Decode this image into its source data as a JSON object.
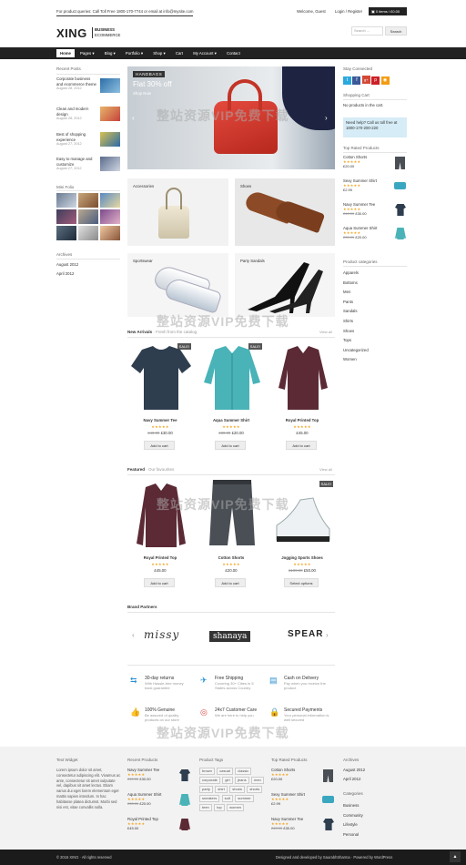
{
  "topbar": {
    "contact": "For product queries: Call Toll Free 1800-170-7744 or email at info@mysite.com",
    "welcome": "Welcome, Guest",
    "login": "Login / Register",
    "cart": "0 items / £0.00"
  },
  "logo": {
    "name": "XING",
    "line1": "BUSINESS",
    "line2": "ECOMMERCE"
  },
  "search": {
    "placeholder": "Search ...",
    "button": "Search"
  },
  "nav": [
    "Home",
    "Pages",
    "Blog",
    "Portfolio",
    "Shop",
    "Cart",
    "My Account",
    "Contact"
  ],
  "recent_posts": {
    "title": "Recent Posts",
    "items": [
      {
        "title": "Corporate business and ecommerce theme",
        "date": "August 28, 2012"
      },
      {
        "title": "Clean and modern design",
        "date": "August 28, 2012"
      },
      {
        "title": "Best of shopping experience",
        "date": "August 27, 2012"
      },
      {
        "title": "Easy to manage and customize",
        "date": "August 27, 2012"
      }
    ]
  },
  "mini_folio": {
    "title": "Mini Folio"
  },
  "archives": {
    "title": "Archives",
    "items": [
      "August 2012",
      "April 2012"
    ]
  },
  "slider": {
    "label": "HANDBAGS",
    "headline": "Flat 30% off",
    "cta": "Shop Now"
  },
  "categories_tiles": [
    "Accessories",
    "Shoes",
    "Sportswear",
    "Party Sandals"
  ],
  "new_arrivals": {
    "title": "New Arrivals",
    "sub": "Fresh from the catalog",
    "view_all": "View all",
    "products": [
      {
        "name": "Navy Summer Tee",
        "old": "£40.00",
        "price": "£30.00",
        "button": "Add to cart",
        "sale": "SALE!"
      },
      {
        "name": "Aqua Summer Shirt",
        "old": "£30.00",
        "price": "£20.00",
        "button": "Add to cart",
        "sale": "SALE!"
      },
      {
        "name": "Royal Printed Top",
        "old": "",
        "price": "£45.00",
        "button": "Add to cart",
        "sale": ""
      }
    ]
  },
  "featured": {
    "title": "Featured",
    "sub": "Our favourites",
    "view_all": "View all",
    "products": [
      {
        "name": "Royal Printed Top",
        "price": "£45.00",
        "button": "Add to cart",
        "sale": ""
      },
      {
        "name": "Cotton Shorts",
        "price": "£20.00",
        "button": "Add to cart",
        "sale": ""
      },
      {
        "name": "Jogging Sports Shoes",
        "old": "£100.00",
        "price": "£50.00",
        "button": "Select options",
        "sale": "SALE!"
      }
    ]
  },
  "brands": {
    "title": "Brand Partners",
    "items": [
      "missy",
      "shanaya",
      "SPEAR"
    ]
  },
  "features": [
    {
      "title": "30-day returns",
      "text": "With Hassle-free money back guarantee"
    },
    {
      "title": "Free Shipping",
      "text": "Covering 30+ Cities in 5 States across Country"
    },
    {
      "title": "Cash on Delivery",
      "text": "Pay when you receive the product"
    },
    {
      "title": "100% Genuine",
      "text": "Be assured of quality products on our store"
    },
    {
      "title": "24x7 Customer Care",
      "text": "We are here to help you"
    },
    {
      "title": "Secured Payments",
      "text": "Your personal information is well secured"
    }
  ],
  "right": {
    "stay_connected": "Stay Connected",
    "shopping_cart": "Shopping Cart",
    "cart_empty": "No products in the cart.",
    "help": "Need help? Call us toll free at 1800-170-200-220",
    "top_rated": "Top Rated Products",
    "top_items": [
      {
        "name": "Cotton Shorts",
        "price": "£20.00"
      },
      {
        "name": "Sexy Summer Shirt",
        "price": "£2.99"
      },
      {
        "name": "Navy Summer Tee",
        "old": "£40.00",
        "price": "£30.00"
      },
      {
        "name": "Aqua Summer Shirt",
        "old": "£30.00",
        "price": "£20.00"
      }
    ],
    "product_categories": "Product categories",
    "categories": [
      "Apparels",
      "Bottoms",
      "Men",
      "Pants",
      "Sandals",
      "Shirts",
      "Shoes",
      "Tops",
      "Uncategorized",
      "Women"
    ]
  },
  "footer": {
    "text_widget_title": "Text Widget",
    "text_widget": "Lorem ipsum dolor sit amet, consectetur adipiscing elit. Vivamus ac ante, consectetur sit amet vulputate vel, dapibus sit amet lectus. Etiam varius dui eget lorem elementum eget mattis sapien interdum. In hac habitasse platea dictumst. Morbi sed nisi est, vitae convallis nulla.",
    "recent_title": "Recent Products",
    "recent": [
      {
        "name": "Navy Summer Tee",
        "old": "£40.00",
        "price": "£30.00"
      },
      {
        "name": "Aqua Summer Shirt",
        "old": "£30.00",
        "price": "£20.00"
      },
      {
        "name": "Royal Printed Top",
        "price": "£45.00"
      }
    ],
    "tags_title": "Product Tags",
    "tags": [
      "brown",
      "casual",
      "classic",
      "corporate",
      "girl",
      "jeans",
      "men",
      "party",
      "shirt",
      "shoes",
      "shorts",
      "sneakers",
      "suit",
      "summer",
      "teen",
      "top",
      "women"
    ],
    "top_title": "Top Rated Products",
    "top": [
      {
        "name": "Cotton Shorts",
        "price": "£20.00"
      },
      {
        "name": "Sexy Summer Shirt",
        "price": "£2.99"
      },
      {
        "name": "Navy Summer Tee",
        "old": "£40.00",
        "price": "£30.00"
      }
    ],
    "archives_title": "Archives",
    "archives": [
      "August 2012",
      "April 2012"
    ],
    "categories_title": "Categories",
    "categories": [
      "Business",
      "Community",
      "Lifestyle",
      "Personal"
    ],
    "copyright": "© 2016 XING · All rights reserved",
    "credits": "Designed and developed by SaurabhSharma · Powered by WordPress"
  },
  "watermark": "整站资源VIP免费下载"
}
